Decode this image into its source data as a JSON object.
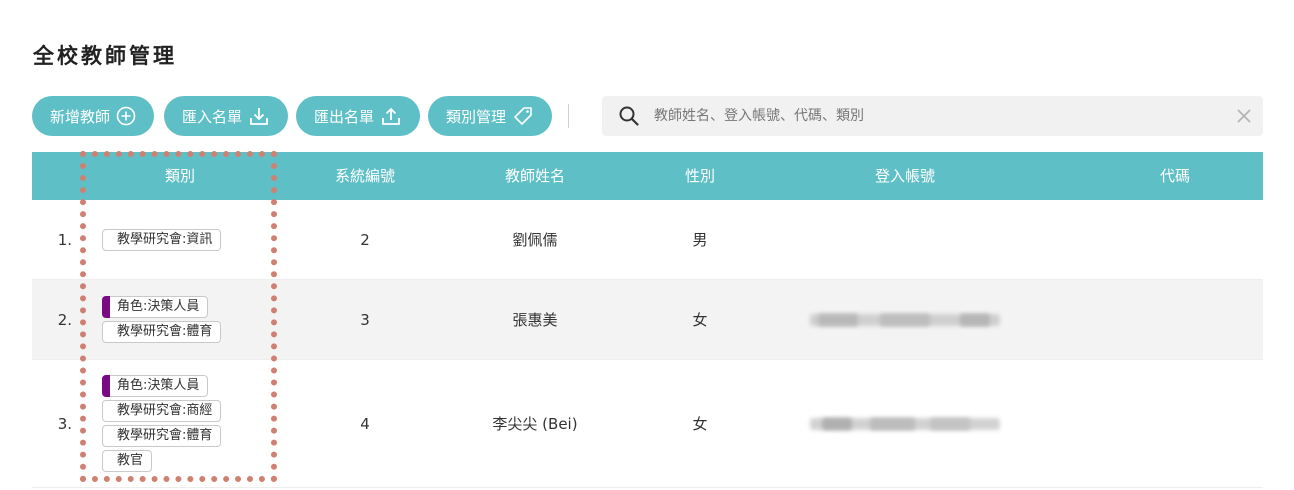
{
  "page": {
    "title": "全校教師管理"
  },
  "toolbar": {
    "add_label": "新增教師",
    "import_label": "匯入名單",
    "export_label": "匯出名單",
    "category_label": "類別管理"
  },
  "search": {
    "placeholder": "教師姓名、登入帳號、代碼、類別",
    "value": ""
  },
  "table": {
    "headers": {
      "category": "類別",
      "system_id": "系統編號",
      "name": "教師姓名",
      "gender": "性別",
      "login": "登入帳號",
      "code": "代碼"
    },
    "rows": [
      {
        "num": "1.",
        "tags": [
          "教學研究會:資訊"
        ],
        "role_tags": [],
        "system_id": "2",
        "name": "劉佩儒",
        "gender": "男",
        "login": "",
        "code": ""
      },
      {
        "num": "2.",
        "tags": [
          "角色:決策人員",
          "教學研究會:體育"
        ],
        "role_tags": [
          "角色:決策人員"
        ],
        "system_id": "3",
        "name": "張惠美",
        "gender": "女",
        "login": "",
        "code": ""
      },
      {
        "num": "3.",
        "tags": [
          "角色:決策人員",
          "教學研究會:商經",
          "教學研究會:體育",
          "教官"
        ],
        "role_tags": [
          "角色:決策人員"
        ],
        "system_id": "4",
        "name": "李尖尖 (Bei)",
        "gender": "女",
        "login": "",
        "code": ""
      }
    ]
  },
  "colors": {
    "accent": "#5fbfc6",
    "role_marker": "#7a0a84",
    "highlight_border": "#d08070",
    "alt_row": "#f3f3f3"
  },
  "icons": {
    "add": "plus-circle-icon",
    "import": "download-icon",
    "export": "upload-icon",
    "category": "tag-icon",
    "search": "search-icon",
    "clear": "close-icon"
  }
}
